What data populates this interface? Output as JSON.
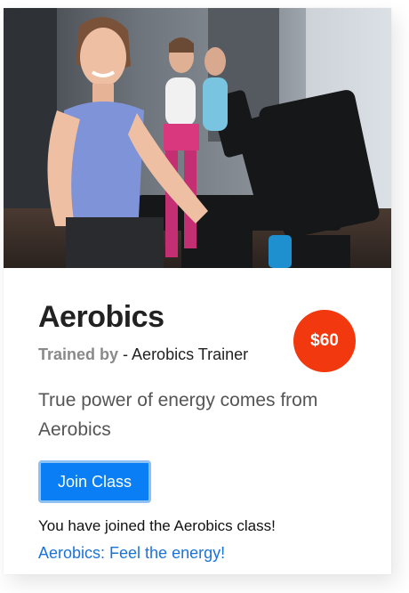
{
  "class_card": {
    "image_alt": "Women exercising on elliptical machines",
    "title": "Aerobics",
    "trainer_prefix": "Trained by",
    "trainer_separator": " - ",
    "trainer_name": "Aerobics Trainer",
    "price": "$60",
    "description": "True power of energy comes from Aerobics",
    "join_button_label": "Join Class",
    "joined_message": "You have joined the Aerobics class!",
    "tagline_link": "Aerobics: Feel the energy!"
  },
  "colors": {
    "price_badge": "#f2380f",
    "button_bg": "#0a7ff5",
    "button_focus_ring": "#8ec1f2",
    "link": "#1a73d9",
    "title": "#222222",
    "muted": "#8a8a8a"
  }
}
